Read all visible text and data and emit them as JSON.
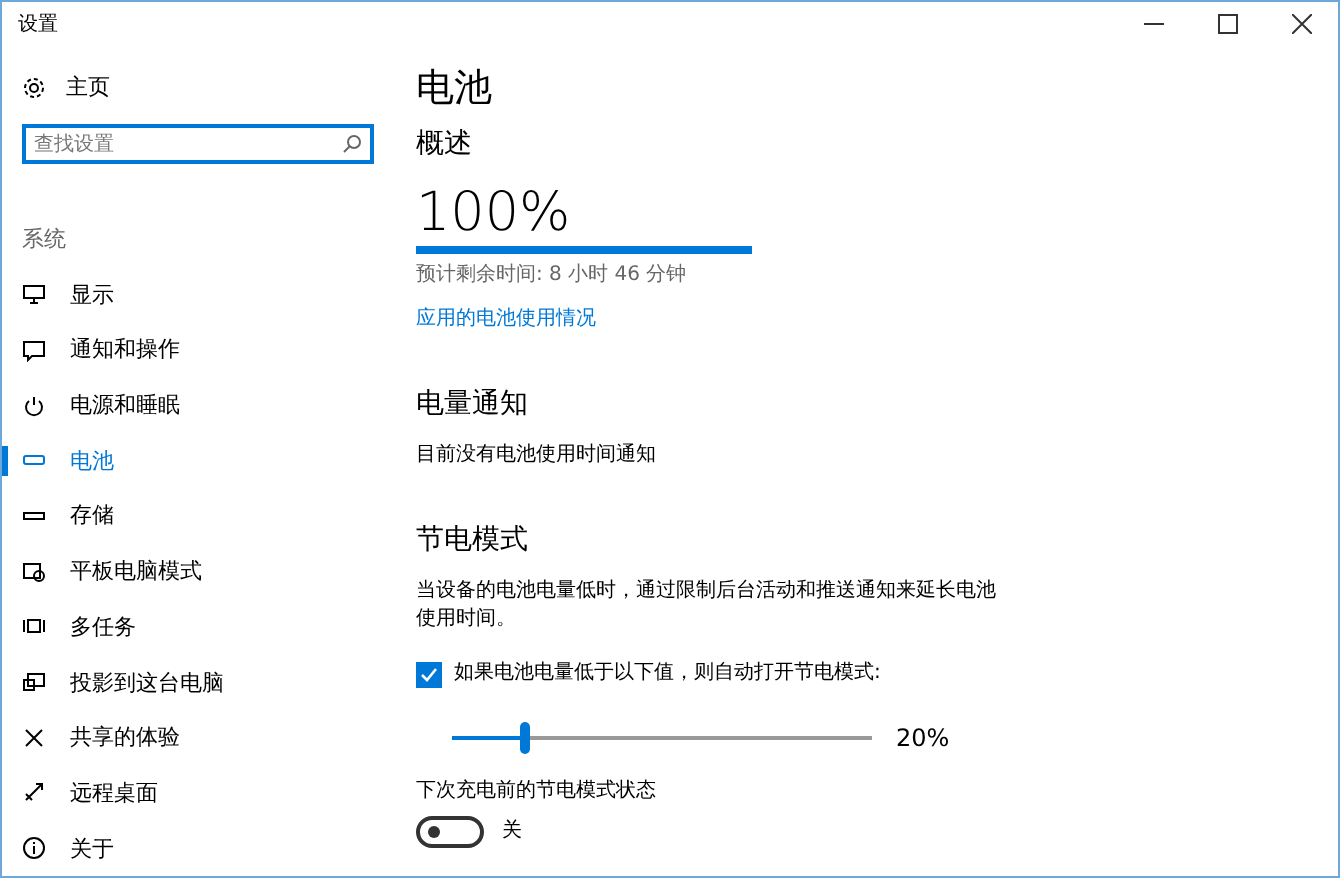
{
  "window": {
    "title": "设置"
  },
  "sidebar": {
    "home": "主页",
    "search": {
      "placeholder": "查找设置"
    },
    "section": "系统",
    "items": [
      {
        "label": "显示",
        "selected": false
      },
      {
        "label": "通知和操作",
        "selected": false
      },
      {
        "label": "电源和睡眠",
        "selected": false
      },
      {
        "label": "电池",
        "selected": true
      },
      {
        "label": "存储",
        "selected": false
      },
      {
        "label": "平板电脑模式",
        "selected": false
      },
      {
        "label": "多任务",
        "selected": false
      },
      {
        "label": "投影到这台电脑",
        "selected": false
      },
      {
        "label": "共享的体验",
        "selected": false
      },
      {
        "label": "远程桌面",
        "selected": false
      },
      {
        "label": "关于",
        "selected": false
      }
    ]
  },
  "main": {
    "title": "电池",
    "overview": {
      "heading": "概述",
      "percent": "100%",
      "level": 1,
      "estimate": "预计剩余时间: 8 小时 46 分钟",
      "link": "应用的电池使用情况"
    },
    "notifications": {
      "heading": "电量通知",
      "text": "目前没有电池使用时间通知"
    },
    "saver": {
      "heading": "节电模式",
      "description": "当设备的电池电量低时，通过限制后台活动和推送通知来延长电池使用时间。",
      "auto": {
        "label": "如果电池电量低于以下值，则自动打开节电模式:",
        "checked": true
      },
      "slider": {
        "level": 0.17,
        "reading": "20%"
      },
      "status": {
        "label": "下次充电前的节电模式状态",
        "on": false,
        "state_text": "关"
      }
    }
  }
}
